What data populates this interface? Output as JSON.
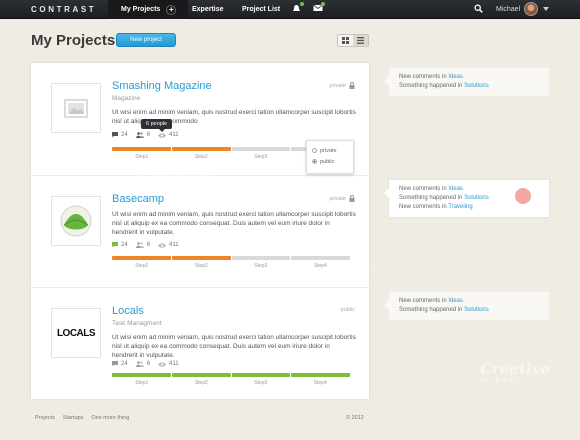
{
  "nav": {
    "logo": "CONTRAST",
    "items": [
      {
        "label": "My Projects"
      },
      {
        "label": "Expertise"
      },
      {
        "label": "Project List"
      }
    ],
    "user_name": "Michael"
  },
  "header": {
    "title": "My Projects",
    "new_project_label": "New project"
  },
  "projects": [
    {
      "title": "Smashing Magazine",
      "subtitle": "Magazine",
      "description": "Ut wisi enim ad minim veniam, quis nostrud exerci tation ullamcorper suscipit lobortis nisl ut aliquip ex ea commodo",
      "privacy": "private",
      "comments": "24",
      "people": "6",
      "views": "411",
      "steps": [
        "Step1",
        "Step2",
        "Step3",
        "Step4"
      ],
      "progress_completed_steps": 2,
      "progress_color": "#ee8424",
      "tooltip": "6 people"
    },
    {
      "title": "Basecamp",
      "subtitle": "",
      "description": "Ut wisi enim ad minim veniam, quis nostrud exerci tation ullamcorper suscipit lobortis nisl ut aliquip ex ea commodo consequat. Duis autem vel eum iriure dolor in hendrerit in vulputate.",
      "privacy": "private",
      "comments": "24",
      "people": "6",
      "views": "411",
      "steps": [
        "Step1",
        "Step2",
        "Step3",
        "Step4"
      ],
      "progress_completed_steps": 2,
      "progress_color": "#ee8424",
      "privacy_menu": {
        "options": [
          "private",
          "public"
        ],
        "selected": "public"
      }
    },
    {
      "title": "Locals",
      "subtitle": "Task Managment",
      "description": "Ut wisi enim ad minim veniam, quis nostrud exerci tation ullamcorper suscipit lobortis nisl ut aliquip ex ea commodo consequat. Duis autem vel eum iriure dolor in hendrerit in vulputate.",
      "privacy": "public",
      "logo_text": "LOCALS",
      "comments": "24",
      "people": "6",
      "views": "411",
      "steps": [
        "Step1",
        "Step2",
        "Step3",
        "Step4"
      ],
      "progress_completed_steps": 4,
      "progress_color": "#7cbd3b"
    }
  ],
  "activity": [
    {
      "lines": [
        {
          "text": "New comments in ",
          "link": "Ideas"
        },
        {
          "text": "Something happened in ",
          "link": "Solutions"
        }
      ]
    },
    {
      "lines": [
        {
          "text": "New comments in ",
          "link": "Ideas"
        },
        {
          "text": "Something happened in ",
          "link": "Solutions"
        },
        {
          "text": "New comments in ",
          "link": "Traveling"
        }
      ]
    },
    {
      "lines": [
        {
          "text": "New comments in ",
          "link": "Ideas"
        },
        {
          "text": "Something happened in ",
          "link": "Solutions"
        }
      ]
    }
  ],
  "footer": {
    "links": [
      "Projects",
      "Startups",
      "One more thing"
    ],
    "copyright": "© 2012"
  },
  "watermark": {
    "brand": "Creative",
    "sub": "MARKET"
  }
}
